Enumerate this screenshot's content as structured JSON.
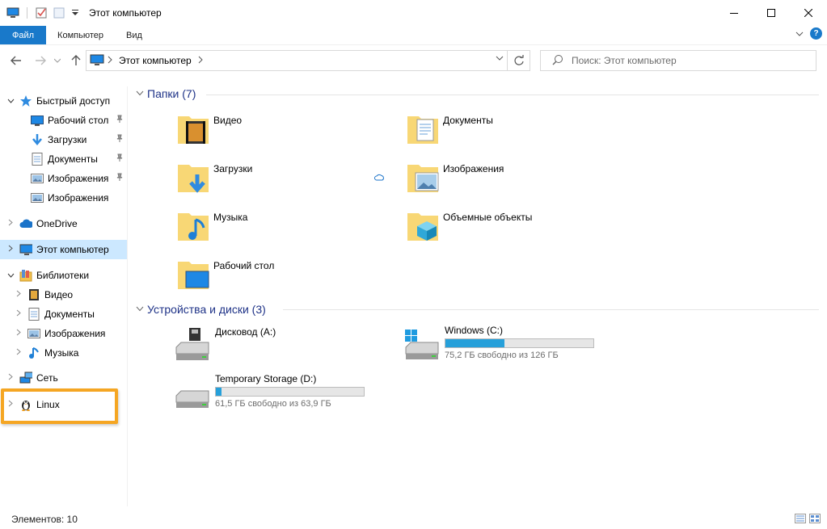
{
  "window": {
    "title": "Этот компьютер"
  },
  "ribbon": {
    "tabs": [
      "Файл",
      "Компьютер",
      "Вид"
    ]
  },
  "address": {
    "crumb": "Этот компьютер",
    "search_placeholder": "Поиск: Этот компьютер"
  },
  "sidebar": {
    "items": [
      {
        "label": "Быстрый доступ",
        "icon": "star-icon"
      },
      {
        "label": "Рабочий стол",
        "icon": "desktop-icon",
        "pinned": true
      },
      {
        "label": "Загрузки",
        "icon": "download-icon",
        "pinned": true
      },
      {
        "label": "Документы",
        "icon": "document-icon",
        "pinned": true
      },
      {
        "label": "Изображения",
        "icon": "pictures-icon",
        "pinned": true
      },
      {
        "label": "Изображения",
        "icon": "pictures-icon"
      },
      {
        "label": "OneDrive",
        "icon": "cloud-icon"
      },
      {
        "label": "Этот компьютер",
        "icon": "computer-icon",
        "selected": true
      },
      {
        "label": "Библиотеки",
        "icon": "library-icon"
      },
      {
        "label": "Видео",
        "icon": "video-icon"
      },
      {
        "label": "Документы",
        "icon": "document-icon"
      },
      {
        "label": "Изображения",
        "icon": "pictures-icon"
      },
      {
        "label": "Музыка",
        "icon": "music-icon"
      },
      {
        "label": "Сеть",
        "icon": "network-icon"
      },
      {
        "label": "Linux",
        "icon": "linux-penguin-icon"
      }
    ]
  },
  "main": {
    "folders_header": "Папки (7)",
    "folders": [
      {
        "label": "Видео",
        "icon": "video-folder-icon"
      },
      {
        "label": "Документы",
        "icon": "documents-folder-icon"
      },
      {
        "label": "Загрузки",
        "icon": "downloads-folder-icon"
      },
      {
        "label": "Изображения",
        "icon": "pictures-folder-icon"
      },
      {
        "label": "Музыка",
        "icon": "music-folder-icon"
      },
      {
        "label": "Объемные объекты",
        "icon": "3d-objects-folder-icon"
      },
      {
        "label": "Рабочий стол",
        "icon": "desktop-folder-icon"
      }
    ],
    "drives_header": "Устройства и диски (3)",
    "drives": [
      {
        "label": "Дисковод (A:)",
        "icon": "floppy-drive-icon"
      },
      {
        "label": "Windows (C:)",
        "icon": "windows-drive-icon",
        "free": "75,2 ГБ свободно из 126 ГБ",
        "used_fraction": 0.4
      },
      {
        "label": "Temporary Storage (D:)",
        "icon": "hdd-icon",
        "free": "61,5 ГБ свободно из 63,9 ГБ",
        "used_fraction": 0.04
      }
    ]
  },
  "status": {
    "count": "Элементов: 10"
  },
  "colors": {
    "accent": "#1979ca",
    "selection": "#cce8ff",
    "drive_bar": "#26a0da",
    "highlight": "#f5a623"
  }
}
